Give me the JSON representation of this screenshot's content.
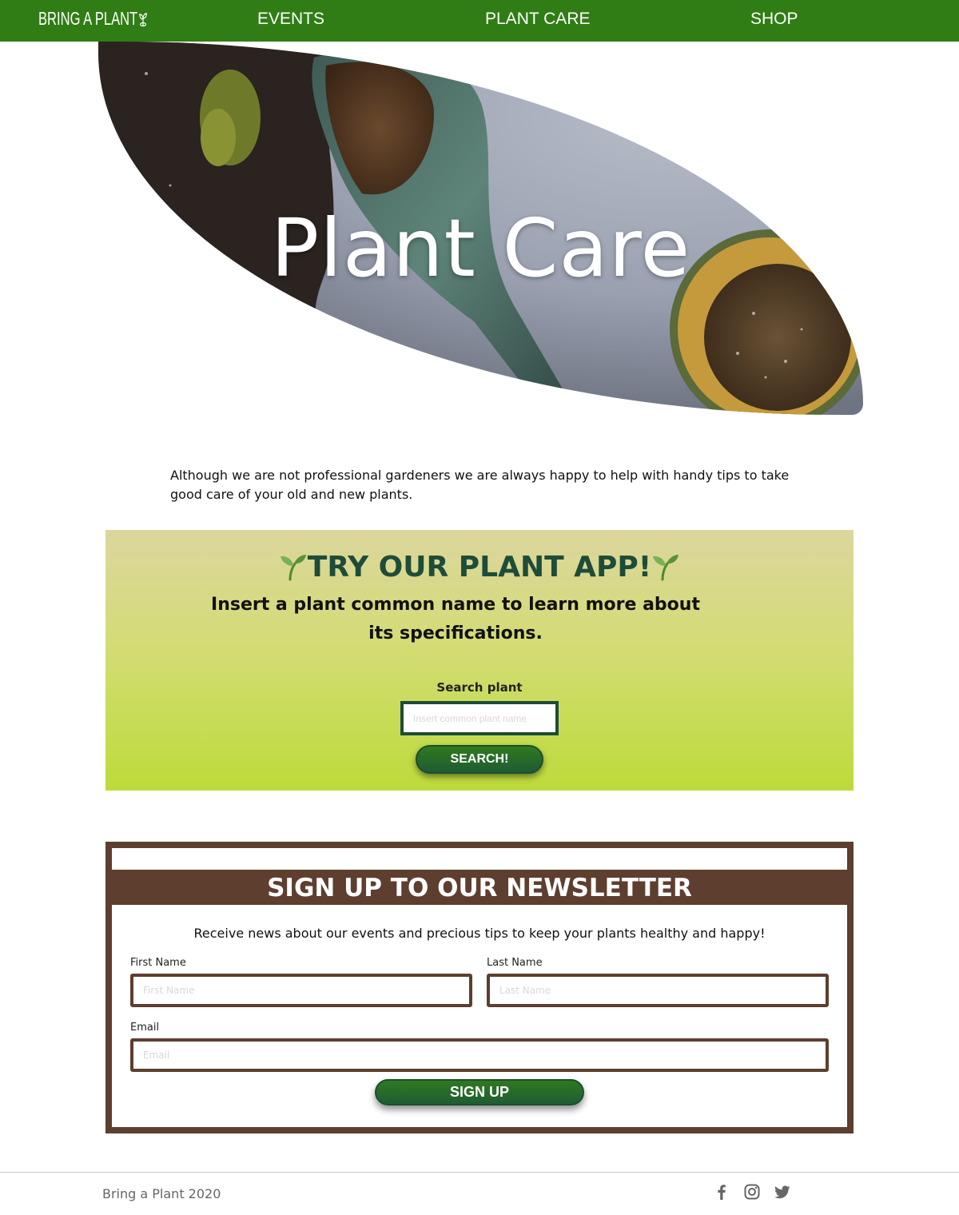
{
  "nav": {
    "logo": "BRING A PLANT",
    "links": [
      "EVENTS",
      "PLANT CARE",
      "SHOP"
    ]
  },
  "hero": {
    "title": "Plant Care"
  },
  "intro": {
    "text": "Although we are not professional gardeners we are always happy to help with handy tips to take good care of your old and new plants."
  },
  "app": {
    "title": "TRY OUR PLANT APP!",
    "subtitle": "Insert a plant common name to learn more about its specifications.",
    "search_label": "Search plant",
    "search_placeholder": "Insert common plant name",
    "search_button": "SEARCH!"
  },
  "newsletter": {
    "title": "SIGN UP TO OUR NEWSLETTER",
    "description": "Receive news about our events and precious tips to keep your plants healthy and happy!",
    "first_name_label": "First Name",
    "first_name_placeholder": "First Name",
    "last_name_label": "Last Name",
    "last_name_placeholder": "Last Name",
    "email_label": "Email",
    "email_placeholder": "Email",
    "button": "SIGN UP"
  },
  "footer": {
    "text": "Bring a Plant 2020",
    "social_icons": [
      "facebook-icon",
      "instagram-icon",
      "twitter-icon"
    ]
  },
  "colors": {
    "nav_green": "#2f7d14",
    "dark_green": "#1e4c3a",
    "brown": "#5e3e2f",
    "lime": "#bcdb3a"
  }
}
